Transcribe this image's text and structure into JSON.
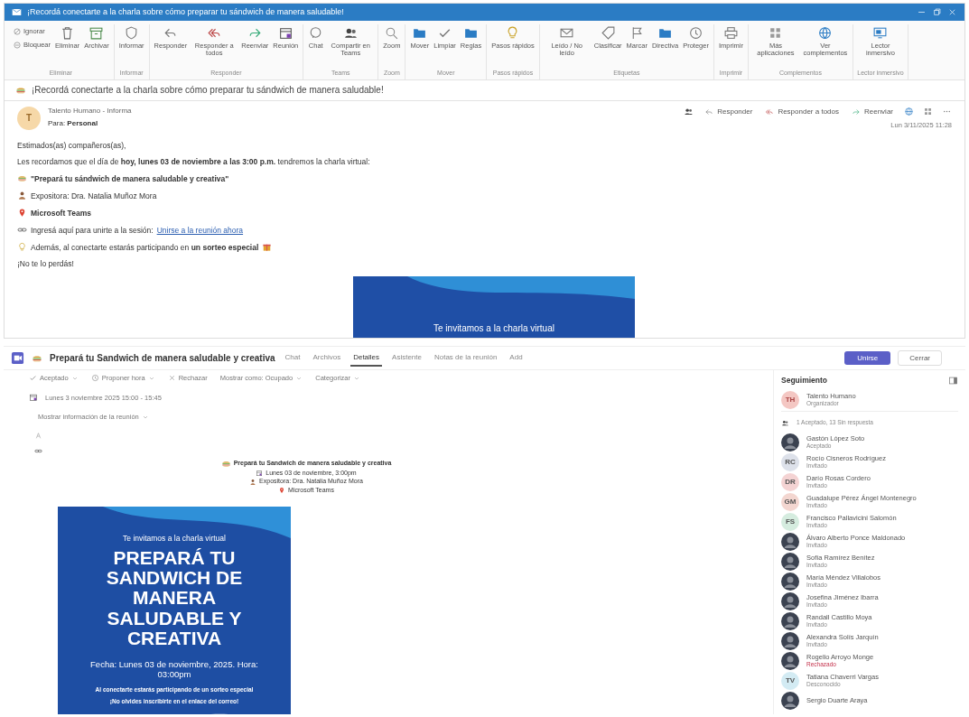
{
  "outlook": {
    "title": "¡Recordá conectarte a la charla sobre cómo preparar tu sándwich de manera saludable!",
    "ribbon": [
      {
        "label": "Eliminar",
        "buttons": [
          "Ignorar",
          "Bloquear",
          "Eliminar",
          "Archivar"
        ]
      },
      {
        "label": "Informar",
        "buttons": [
          "Informar"
        ]
      },
      {
        "label": "Responder",
        "buttons": [
          "Responder",
          "Responder a todos",
          "Reenviar",
          "Reunión"
        ]
      },
      {
        "label": "Teams",
        "buttons": [
          "Chat",
          "Compartir en Teams"
        ]
      },
      {
        "label": "Zoom",
        "buttons": [
          "Zoom"
        ]
      },
      {
        "label": "Mover",
        "buttons": [
          "Mover",
          "Limpiar",
          "Reglas"
        ]
      },
      {
        "label": "Pasos rápidos",
        "buttons": [
          "Pasos rápidos"
        ]
      },
      {
        "label": "Etiquetas",
        "buttons": [
          "Leído / No leído",
          "Clasificar",
          "Marcar",
          "Directiva",
          "Proteger"
        ]
      },
      {
        "label": "Imprimir",
        "buttons": [
          "Imprimir"
        ]
      },
      {
        "label": "Complementos",
        "buttons": [
          "Más aplicaciones",
          "Ver complementos"
        ]
      },
      {
        "label": "Lector inmersivo",
        "buttons": [
          "Lector inmersivo"
        ]
      }
    ],
    "subject": "¡Recordá conectarte a la charla sobre cómo preparar tu sándwich de manera saludable!",
    "sender": {
      "initials": "T",
      "name": "Talento Humano - Informa",
      "to_label": "Para:",
      "to": "Personal"
    },
    "actions": [
      "Responder",
      "Responder a todos",
      "Reenviar"
    ],
    "date": "Lun 3/11/2025 11:28",
    "body": [
      {
        "kind": "plain",
        "text": "Estimados(as) compañeros(as),"
      },
      {
        "kind": "plain",
        "text": "Les recordamos que el día de **hoy, lunes 03 de noviembre a las 3:00 p.m.** tendremos la charla virtual:"
      },
      {
        "kind": "title",
        "text": "**\"Prepará tu sándwich de manera saludable y creativa\"**"
      },
      {
        "kind": "speaker",
        "text": "Expositora: Dra. Natalia Muñoz Mora"
      },
      {
        "kind": "place",
        "text": "**Microsoft Teams**"
      },
      {
        "kind": "link",
        "text": "Ingresá aquí para unirte a la sesión:",
        "link": "Unirse a la reunión ahora"
      },
      {
        "kind": "raffle",
        "text": "Además, al conectarte estarás participando en **un sorteo especial**"
      },
      {
        "kind": "plain",
        "text": "¡No te lo perdás!"
      }
    ],
    "banner": {
      "text": "Te invitamos a la charla virtual"
    }
  },
  "teams": {
    "title": "Prepará tu Sandwich de manera saludable y creativa",
    "tabs": [
      {
        "label": "Chat",
        "selected": false
      },
      {
        "label": "Archivos",
        "selected": false
      },
      {
        "label": "Detalles",
        "selected": true
      },
      {
        "label": "Asistente",
        "selected": false
      },
      {
        "label": "Notas de la reunión",
        "selected": false
      },
      {
        "label": "Add",
        "selected": false
      }
    ],
    "join_button": "Unirse",
    "close_button": "Cerrar",
    "toolbar": [
      {
        "label": "Aceptado",
        "caret": true
      },
      {
        "label": "Proponer hora",
        "caret": true
      },
      {
        "label": "Rechazar",
        "caret": false
      },
      {
        "label": "Mostrar como: Ocupado",
        "caret": true
      },
      {
        "label": "Categorizar",
        "caret": true
      }
    ],
    "when": "Lunes 3 noviembre 2025 15:00 - 15:45",
    "details_link": "Mostrar información de la reunión",
    "agenda": [
      {
        "kind": "title",
        "text": "Prepará tu Sandwich de manera saludable y creativa"
      },
      {
        "kind": "date",
        "text": "Lunes 03 de noviembre, 3:00pm"
      },
      {
        "kind": "speaker",
        "text": "Expositora: Dra. Natalia Muñoz Mora"
      },
      {
        "kind": "place",
        "text": "Microsoft Teams"
      }
    ],
    "poster": {
      "intro": "Te invitamos a la charla virtual",
      "headline": "PREPARÁ TU SANDWICH DE MANERA SALUDABLE Y CREATIVA",
      "date": "Fecha: Lunes 03 de noviembre, 2025. Hora: 03:00pm",
      "raffle": "Al conectarte estarás participando de un sorteo especial",
      "reminder": "¡No olvides inscribirte en el enlace del correo!"
    },
    "tracking": {
      "title": "Seguimiento",
      "organizer": {
        "initials": "TH",
        "color": "#f4c7c3",
        "name": "Talento Humano",
        "role": "Organizador"
      },
      "summary": "1 Aceptado, 13 Sin respuesta",
      "attendees": [
        {
          "kind": "photo",
          "name": "Gastón López Soto",
          "status": "Aceptado",
          "declined": false
        },
        {
          "kind": "initials",
          "initials": "RC",
          "color": "#dde1ea",
          "name": "Rocío Cisneros Rodríguez",
          "status": "Invitado",
          "declined": false
        },
        {
          "kind": "initials",
          "initials": "DR",
          "color": "#f4d3d3",
          "name": "Darío Rosas Cordero",
          "status": "Invitado",
          "declined": false
        },
        {
          "kind": "initials",
          "initials": "GM",
          "color": "#f3d6d0",
          "name": "Guadalupe Pérez Ángel Montenegro",
          "status": "Invitado",
          "declined": false
        },
        {
          "kind": "initials",
          "initials": "FS",
          "color": "#d5ecdf",
          "name": "Francisco Pallavicini Salomón",
          "status": "Invitado",
          "declined": false
        },
        {
          "kind": "photo",
          "name": "Álvaro Alberto Ponce Maldonado",
          "status": "Invitado",
          "declined": false
        },
        {
          "kind": "photo",
          "name": "Sofía Ramírez Benítez",
          "status": "Invitado",
          "declined": false
        },
        {
          "kind": "photo",
          "name": "María Méndez Villalobos",
          "status": "Invitado",
          "declined": false
        },
        {
          "kind": "photo",
          "name": "Josefina Jiménez Ibarra",
          "status": "Invitado",
          "declined": false
        },
        {
          "kind": "photo",
          "name": "Randall Castillo Moya",
          "status": "Invitado",
          "declined": false
        },
        {
          "kind": "photo",
          "name": "Alexandra Solís Jarquín",
          "status": "Invitado",
          "declined": false
        },
        {
          "kind": "photo",
          "name": "Rogelio Arroyo Monge",
          "status": "Rechazado",
          "declined": true
        },
        {
          "kind": "initials",
          "initials": "TV",
          "color": "#d3ebf3",
          "name": "Tatiana Chaverri Vargas",
          "status": "Desconocido",
          "declined": false
        },
        {
          "kind": "photo",
          "name": "Sergio Duarte Araya"
        }
      ]
    }
  }
}
